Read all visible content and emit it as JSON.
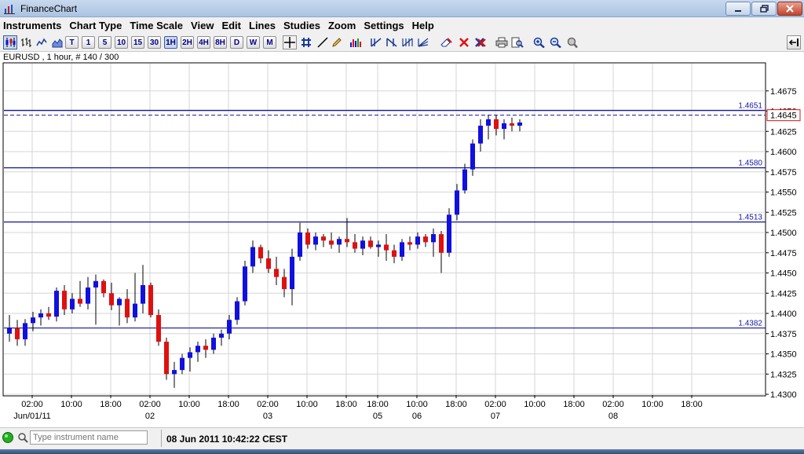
{
  "window": {
    "title": "FinanceChart"
  },
  "menu": [
    "Instruments",
    "Chart Type",
    "Time Scale",
    "View",
    "Edit",
    "Lines",
    "Studies",
    "Zoom",
    "Settings",
    "Help"
  ],
  "timeframes": [
    {
      "label": "T",
      "active": false
    },
    {
      "label": "1",
      "active": false
    },
    {
      "label": "5",
      "active": false
    },
    {
      "label": "10",
      "active": false
    },
    {
      "label": "15",
      "active": false
    },
    {
      "label": "30",
      "active": false
    },
    {
      "label": "1H",
      "active": true
    },
    {
      "label": "2H",
      "active": false
    },
    {
      "label": "4H",
      "active": false
    },
    {
      "label": "8H",
      "active": false
    },
    {
      "label": "D",
      "active": false
    },
    {
      "label": "W",
      "active": false
    },
    {
      "label": "M",
      "active": false
    }
  ],
  "chart_info": "EURUSD , 1 hour, # 140 / 300",
  "colors": {
    "up": "#1010e0",
    "down": "#e01010",
    "hline": "#1515a0",
    "price_line": "#1515a0"
  },
  "chart_data": {
    "type": "candlestick",
    "symbol": "EURUSD",
    "ylim": [
      1.43,
      1.47
    ],
    "y_ticks": [
      1.43,
      1.4325,
      1.435,
      1.4375,
      1.44,
      1.4425,
      1.445,
      1.4475,
      1.45,
      1.4525,
      1.455,
      1.4575,
      1.46,
      1.4625,
      1.465,
      1.4675
    ],
    "x_ticks": [
      {
        "i": 3,
        "time": "02:00",
        "date": "Jun/01/11"
      },
      {
        "i": 8,
        "time": "10:00",
        "date": ""
      },
      {
        "i": 13,
        "time": "18:00",
        "date": ""
      },
      {
        "i": 18,
        "time": "02:00",
        "date": "02"
      },
      {
        "i": 23,
        "time": "10:00",
        "date": ""
      },
      {
        "i": 28,
        "time": "18:00",
        "date": ""
      },
      {
        "i": 33,
        "time": "02:00",
        "date": "03"
      },
      {
        "i": 38,
        "time": "10:00",
        "date": ""
      },
      {
        "i": 43,
        "time": "18:00",
        "date": ""
      },
      {
        "i": 47,
        "time": "18:00",
        "date": "05"
      },
      {
        "i": 52,
        "time": "10:00",
        "date": "06"
      },
      {
        "i": 57,
        "time": "18:00",
        "date": ""
      },
      {
        "i": 62,
        "time": "02:00",
        "date": "07"
      },
      {
        "i": 67,
        "time": "10:00",
        "date": ""
      },
      {
        "i": 72,
        "time": "18:00",
        "date": ""
      },
      {
        "i": 77,
        "time": "02:00",
        "date": "08"
      },
      {
        "i": 82,
        "time": "10:00",
        "date": ""
      },
      {
        "i": 87,
        "time": "18:00",
        "date": ""
      }
    ],
    "horizontal_lines": [
      {
        "value": 1.4651,
        "label": "1.4651"
      },
      {
        "value": 1.458,
        "label": "1.4580"
      },
      {
        "value": 1.4513,
        "label": "1.4513"
      },
      {
        "value": 1.4382,
        "label": "1.4382"
      }
    ],
    "current_price": {
      "value": 1.4645,
      "label": "1.4645"
    },
    "candles": [
      [
        1.4375,
        1.4398,
        1.4365,
        1.4382
      ],
      [
        1.4382,
        1.4392,
        1.436,
        1.4368
      ],
      [
        1.4368,
        1.4393,
        1.436,
        1.4388
      ],
      [
        1.4388,
        1.4402,
        1.4378,
        1.4395
      ],
      [
        1.4395,
        1.4405,
        1.4385,
        1.44
      ],
      [
        1.44,
        1.4408,
        1.4392,
        1.4396
      ],
      [
        1.4396,
        1.4432,
        1.439,
        1.4428
      ],
      [
        1.4428,
        1.4435,
        1.4398,
        1.4405
      ],
      [
        1.4405,
        1.4425,
        1.44,
        1.4418
      ],
      [
        1.4418,
        1.444,
        1.4408,
        1.4412
      ],
      [
        1.4412,
        1.4445,
        1.4405,
        1.4432
      ],
      [
        1.4432,
        1.4448,
        1.4386,
        1.444
      ],
      [
        1.444,
        1.4442,
        1.442,
        1.4425
      ],
      [
        1.4425,
        1.4438,
        1.4404,
        1.441
      ],
      [
        1.441,
        1.442,
        1.4385,
        1.4418
      ],
      [
        1.4418,
        1.443,
        1.4388,
        1.4395
      ],
      [
        1.4395,
        1.445,
        1.439,
        1.4412
      ],
      [
        1.4412,
        1.446,
        1.44,
        1.4435
      ],
      [
        1.4435,
        1.4438,
        1.4395,
        1.4398
      ],
      [
        1.4398,
        1.4405,
        1.436,
        1.4365
      ],
      [
        1.4365,
        1.437,
        1.4318,
        1.4325
      ],
      [
        1.4325,
        1.434,
        1.4308,
        1.433
      ],
      [
        1.433,
        1.435,
        1.4325,
        1.4345
      ],
      [
        1.4345,
        1.4358,
        1.4328,
        1.4352
      ],
      [
        1.4352,
        1.4365,
        1.434,
        1.436
      ],
      [
        1.436,
        1.4368,
        1.4345,
        1.4355
      ],
      [
        1.4355,
        1.4375,
        1.435,
        1.437
      ],
      [
        1.437,
        1.438,
        1.436,
        1.4375
      ],
      [
        1.4375,
        1.4398,
        1.4368,
        1.4392
      ],
      [
        1.4392,
        1.442,
        1.4386,
        1.4415
      ],
      [
        1.4415,
        1.4465,
        1.441,
        1.4458
      ],
      [
        1.4458,
        1.449,
        1.445,
        1.4482
      ],
      [
        1.4482,
        1.4485,
        1.4462,
        1.4468
      ],
      [
        1.4468,
        1.4478,
        1.445,
        1.4455
      ],
      [
        1.4455,
        1.447,
        1.4435,
        1.4445
      ],
      [
        1.4445,
        1.4455,
        1.442,
        1.443
      ],
      [
        1.443,
        1.448,
        1.441,
        1.447
      ],
      [
        1.447,
        1.4512,
        1.4465,
        1.45
      ],
      [
        1.45,
        1.4505,
        1.448,
        1.4485
      ],
      [
        1.4485,
        1.45,
        1.4478,
        1.4495
      ],
      [
        1.4495,
        1.4498,
        1.4482,
        1.449
      ],
      [
        1.449,
        1.45,
        1.448,
        1.4485
      ],
      [
        1.4485,
        1.4495,
        1.4475,
        1.4492
      ],
      [
        1.4492,
        1.4518,
        1.4482,
        1.4488
      ],
      [
        1.4488,
        1.4498,
        1.4475,
        1.448
      ],
      [
        1.448,
        1.4495,
        1.4472,
        1.449
      ],
      [
        1.449,
        1.4495,
        1.448,
        1.4482
      ],
      [
        1.4482,
        1.449,
        1.447,
        1.4485
      ],
      [
        1.4485,
        1.4498,
        1.4465,
        1.4478
      ],
      [
        1.4478,
        1.4485,
        1.4462,
        1.447
      ],
      [
        1.447,
        1.4492,
        1.4465,
        1.4488
      ],
      [
        1.4488,
        1.4495,
        1.4478,
        1.4485
      ],
      [
        1.4485,
        1.45,
        1.448,
        1.4495
      ],
      [
        1.4495,
        1.4498,
        1.4482,
        1.4488
      ],
      [
        1.4488,
        1.4505,
        1.447,
        1.4498
      ],
      [
        1.4498,
        1.4502,
        1.445,
        1.4475
      ],
      [
        1.4475,
        1.453,
        1.447,
        1.4522
      ],
      [
        1.4522,
        1.456,
        1.4515,
        1.4552
      ],
      [
        1.4552,
        1.4585,
        1.4548,
        1.4578
      ],
      [
        1.4578,
        1.4615,
        1.457,
        1.461
      ],
      [
        1.461,
        1.464,
        1.46,
        1.4632
      ],
      [
        1.4632,
        1.4645,
        1.4615,
        1.464
      ],
      [
        1.464,
        1.4645,
        1.462,
        1.4628
      ],
      [
        1.4628,
        1.464,
        1.4615,
        1.4635
      ],
      [
        1.4635,
        1.4642,
        1.4625,
        1.4632
      ],
      [
        1.4632,
        1.464,
        1.4625,
        1.4636
      ]
    ]
  },
  "status": {
    "search_placeholder": "Type instrument name",
    "datetime": "08 Jun 2011 10:42:22 CEST"
  }
}
